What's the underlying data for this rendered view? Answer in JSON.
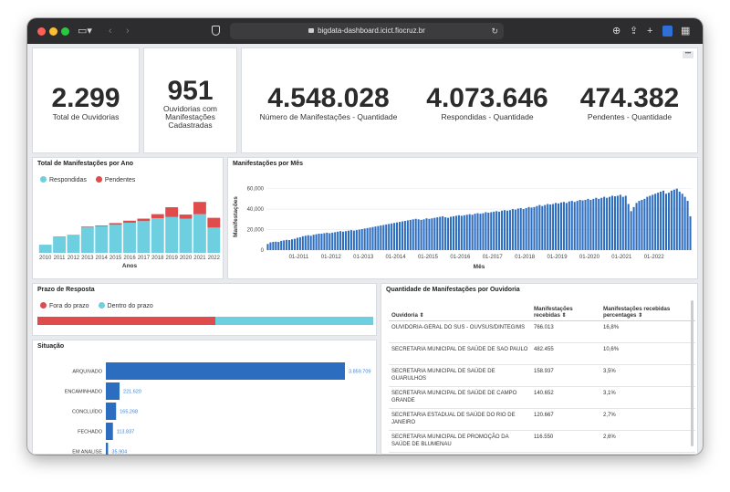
{
  "browser": {
    "url": "bigdata-dashboard.icict.fiocruz.br"
  },
  "kpis": {
    "ouvidorias_total": {
      "value": "2.299",
      "label": "Total de Ouvidorias"
    },
    "ouvidorias_cadastradas": {
      "value": "951",
      "label_line1": "Ouvidorias com",
      "label_line2": "Manifestações",
      "label_line3": "Cadastradas"
    },
    "manifestacoes": {
      "value": "4.548.028",
      "label": "Número de Manifestações - Quantidade"
    },
    "respondidas": {
      "value": "4.073.646",
      "label": "Respondidas - Quantidade"
    },
    "pendentes": {
      "value": "474.382",
      "label": "Pendentes - Quantidade"
    }
  },
  "panel_menu_label": "•••",
  "manif_ano": {
    "title": "Total de Manifestações por Ano",
    "legend_respondidas": "Respondidas",
    "legend_pendentes": "Pendentes",
    "xlabel": "Anos",
    "colors": {
      "respondidas": "#6dcfe0",
      "pendentes": "#e04b4b"
    }
  },
  "manif_mes": {
    "title": "Manifestações por Mês",
    "ylabel": "Manifestações",
    "xlabel": "Mês",
    "color": "#2c6dbf"
  },
  "prazo": {
    "title": "Prazo de Resposta",
    "legend_fora": "Fora do prazo",
    "legend_dentro": "Dentro do prazo",
    "fora_share": 0.53,
    "colors": {
      "fora": "#e04b4b",
      "dentro": "#6dcfe0"
    }
  },
  "situacao": {
    "title": "Situação",
    "color": "#2c6dbf"
  },
  "ouvidoria_table": {
    "title": "Quantidade de Manifestações por Ouvidoria",
    "headers": [
      "Ouvidoria ⇕",
      "Manifestações recebidas ⇕",
      "Manifestações recebidas percentages ⇕"
    ],
    "rows": [
      [
        "OUVIDORIA-GERAL DO SUS - OUVSUS/DINTEG/MS",
        "766.013",
        "16,8%"
      ],
      [
        "SECRETARIA MUNICIPAL DE SAÚDE DE SAO PAULO",
        "482.455",
        "10,6%"
      ],
      [
        "SECRETARIA MUNICIPAL DE SAÚDE DE GUARULHOS",
        "158.937",
        "3,5%"
      ],
      [
        "SECRETARIA MUNICIPAL DE SAÚDE DE CAMPO GRANDE",
        "140.652",
        "3,1%"
      ],
      [
        "SECRETARIA ESTADUAL DE SAÚDE DO RIO DE JANEIRO",
        "120.667",
        "2,7%"
      ],
      [
        "SECRETARIA MUNICIPAL DE PROMOÇÃO DA SAÚDE DE BLUMENAU",
        "116.550",
        "2,6%"
      ]
    ]
  },
  "chart_data": [
    {
      "type": "bar",
      "stacked": true,
      "title": "Total de Manifestações por Ano",
      "xlabel": "Anos",
      "categories": [
        "2010",
        "2011",
        "2012",
        "2013",
        "2014",
        "2015",
        "2016",
        "2017",
        "2018",
        "2019",
        "2020",
        "2021",
        "2022"
      ],
      "series": [
        {
          "name": "Respondidas",
          "values": [
            100,
            195,
            215,
            320,
            325,
            345,
            370,
            390,
            425,
            440,
            420,
            475,
            310
          ]
        },
        {
          "name": "Pendentes",
          "values": [
            0,
            5,
            5,
            5,
            10,
            20,
            25,
            30,
            50,
            120,
            50,
            150,
            120
          ]
        }
      ],
      "ylim": [
        0,
        650
      ],
      "legend_position": "top-left"
    },
    {
      "type": "bar",
      "title": "Manifestações por Mês",
      "xlabel": "Mês",
      "ylabel": "Manifestações",
      "x_ticks": [
        "01-2011",
        "01-2012",
        "01-2013",
        "01-2014",
        "01-2015",
        "01-2016",
        "01-2017",
        "01-2018",
        "01-2019",
        "01-2020",
        "01-2021",
        "01-2022"
      ],
      "y_ticks": [
        "0",
        "20,000",
        "40,000",
        "60,000"
      ],
      "ylim": [
        0,
        65000
      ],
      "monthly_start": "2010-01",
      "values": [
        6000,
        7500,
        8000,
        8200,
        8000,
        9000,
        9500,
        10000,
        9800,
        10500,
        11000,
        12000,
        12500,
        13500,
        14000,
        14500,
        14000,
        15000,
        15500,
        16000,
        16000,
        16500,
        17000,
        16500,
        17000,
        17500,
        18000,
        18500,
        18000,
        18500,
        19000,
        19500,
        19000,
        19500,
        20000,
        20500,
        21000,
        21500,
        22000,
        22500,
        23000,
        23500,
        24000,
        24500,
        25000,
        25500,
        26000,
        26500,
        27000,
        27500,
        28000,
        28500,
        29000,
        29500,
        30000,
        30500,
        30000,
        29500,
        30000,
        31000,
        30500,
        31000,
        31500,
        32000,
        32500,
        33000,
        32000,
        31500,
        32500,
        33000,
        33500,
        34000,
        33500,
        34000,
        34500,
        35000,
        34500,
        35500,
        36000,
        35500,
        36000,
        37000,
        36500,
        37000,
        37500,
        38000,
        37500,
        38500,
        39000,
        38500,
        39000,
        40000,
        39500,
        40500,
        41000,
        40000,
        41000,
        42000,
        41500,
        42000,
        43000,
        44000,
        43000,
        44000,
        45000,
        44500,
        45000,
        46000,
        45500,
        46500,
        47000,
        46000,
        47500,
        48000,
        47000,
        48000,
        49000,
        48500,
        49000,
        50000,
        49000,
        50000,
        51000,
        50000,
        51000,
        52000,
        51000,
        52000,
        53000,
        52500,
        53000,
        54000,
        52000,
        53000,
        45000,
        38000,
        42000,
        46000,
        48000,
        49000,
        50000,
        52000,
        53000,
        54000,
        55000,
        56000,
        57000,
        58000,
        55000,
        56000,
        58000,
        59000,
        60000,
        57000,
        55000,
        52000,
        48000,
        33000
      ]
    },
    {
      "type": "bar",
      "orientation": "horizontal",
      "title": "Situação",
      "categories": [
        "ARQUIVADO",
        "ENCAMINHADO",
        "CONCLUÍDO",
        "FECHADO",
        "EM ANALISE"
      ],
      "values": [
        3859709,
        221620,
        165268,
        113837,
        35904
      ],
      "value_labels": [
        "3.859.709",
        "221.620",
        "165.268",
        "113.837",
        "35.904"
      ]
    },
    {
      "type": "bar",
      "orientation": "horizontal",
      "stacked": true,
      "title": "Prazo de Resposta",
      "series": [
        {
          "name": "Fora do prazo",
          "share": 0.53
        },
        {
          "name": "Dentro do prazo",
          "share": 0.47
        }
      ]
    }
  ]
}
